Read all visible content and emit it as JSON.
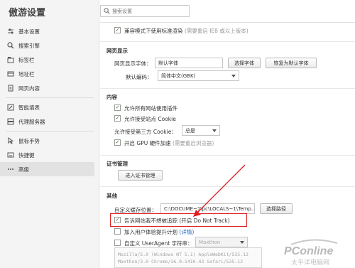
{
  "sidebar": {
    "title": "傲游设置",
    "items": [
      {
        "label": "基本设置",
        "icon": "sliders-icon"
      },
      {
        "label": "搜索引擎",
        "icon": "search-icon"
      },
      {
        "label": "标签栏",
        "icon": "tabs-icon"
      },
      {
        "label": "地址栏",
        "icon": "address-bar-icon"
      },
      {
        "label": "网页内容",
        "icon": "document-icon"
      },
      {
        "label": "智能填表",
        "icon": "pencil-icon"
      },
      {
        "label": "代理服务器",
        "icon": "server-icon"
      },
      {
        "label": "鼠标手势",
        "icon": "mouse-icon"
      },
      {
        "label": "快捷键",
        "icon": "keyboard-icon"
      },
      {
        "label": "高级",
        "icon": "more-icon"
      }
    ],
    "active_index": 9
  },
  "search": {
    "placeholder": "搜索设置"
  },
  "top_option": {
    "label": "兼容模式下使用标准渲染",
    "hint": "(需要重启 IE8 或以上版本)",
    "checked": true
  },
  "web_display": {
    "section_title": "网页显示",
    "font_label": "网页显示字体：",
    "font_value": "默认字体",
    "choose_font_button": "选择字体",
    "restore_font_button": "恢复为默认字体",
    "encoding_label": "默认编码：",
    "encoding_value": "简体中文(GBK)"
  },
  "content": {
    "section_title": "内容",
    "allow_plugins": {
      "label": "允许所有网站使用插件",
      "checked": true
    },
    "accept_cookie": {
      "label": "允许接受站点 Cookie",
      "checked": true
    },
    "third_party_label": "允许接受第三方 Cookie：",
    "third_party_value": "总是",
    "gpu": {
      "label": "开启 GPU 硬件加速",
      "hint": "(需要重启浏览器)",
      "checked": true
    }
  },
  "certificates": {
    "section_title": "证书管理",
    "import_button": "进入证书管理"
  },
  "other": {
    "section_title": "其他",
    "cache_label": "自定义缓存位置：",
    "cache_value": "C:\\DOCUME~1\\pc\\LOCALS~1\\Temp...",
    "choose_path_button": "选择路径",
    "dnt": {
      "label": "告诉网站我不想被追踪 (开启 Do Not Track)",
      "checked": true
    },
    "experience": {
      "label": "加入用户体验提升计划",
      "link": "(详情)",
      "checked": false
    },
    "ua": {
      "label": "自定义 UserAgent 字符串：",
      "select_value": "Maxthon",
      "checked": false
    },
    "ua_lines": [
      "Mozilla/5.0 (Windows NT 5.1) AppleWebKit/535.12",
      "Maxthon/3.0 Chrome/26.0.1410.43 Safari/535.12"
    ]
  },
  "watermark": {
    "brand": "PConline",
    "sub": "太平洋电脑网"
  },
  "colors": {
    "highlight": "#e02020",
    "check": "#2b6e1a",
    "link": "#1a5fb4",
    "watermark": "#b8b8b8"
  }
}
